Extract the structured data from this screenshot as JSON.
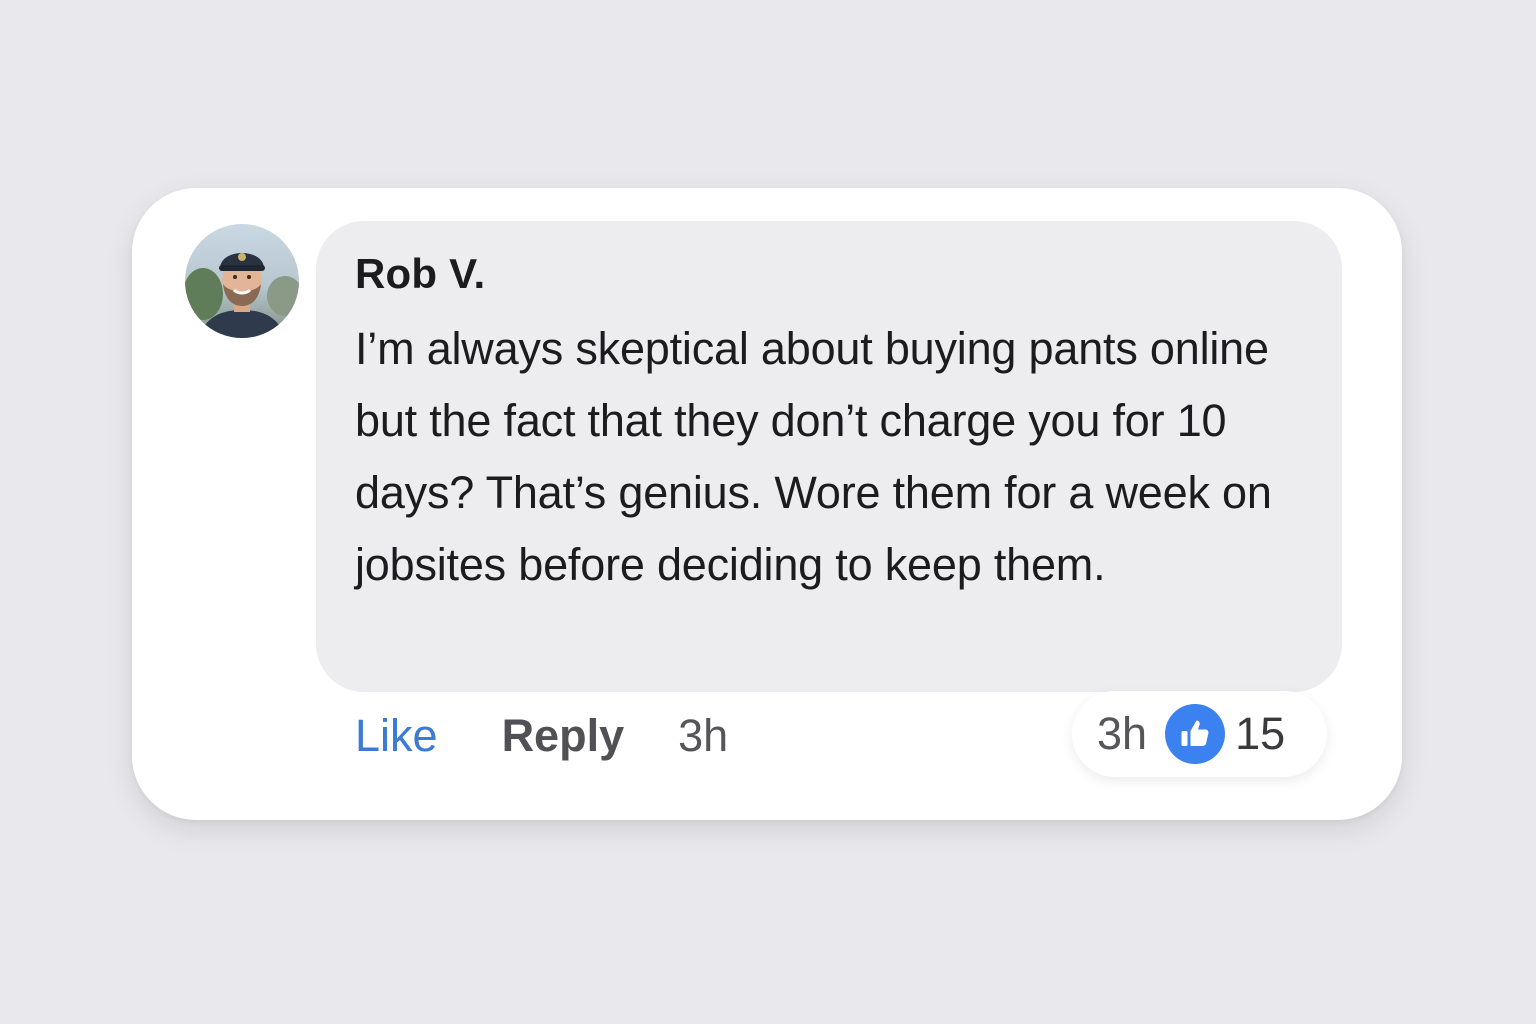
{
  "comment": {
    "author": "Rob V.",
    "text": "I’m always skeptical about buying pants online but the fact that they don’t charge you for 10 days? That’s genius. Wore them for a week on jobsites before deciding to keep them.",
    "avatar_icon": "user-avatar-photo"
  },
  "actions": {
    "like_label": "Like",
    "reply_label": "Reply",
    "time": "3h"
  },
  "reactions": {
    "time": "3h",
    "icon": "thumbs-up-icon",
    "count": "15",
    "badge_color": "#3b82f0"
  },
  "colors": {
    "background": "#e9e9ed",
    "card": "#ffffff",
    "bubble": "#ededf0",
    "like_link": "#3a7bd5"
  }
}
